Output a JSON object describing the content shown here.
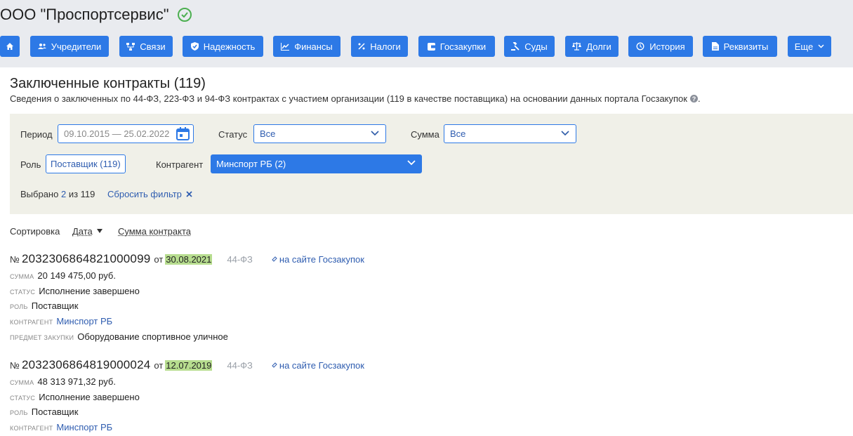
{
  "company": {
    "title": "ООО \"Проспортсервис\""
  },
  "nav": {
    "home_label": "",
    "items": [
      {
        "label": "Учредители",
        "icon": "users-icon"
      },
      {
        "label": "Связи",
        "icon": "links-icon"
      },
      {
        "label": "Надежность",
        "icon": "shield-check-icon"
      },
      {
        "label": "Финансы",
        "icon": "chart-icon"
      },
      {
        "label": "Налоги",
        "icon": "percent-icon"
      },
      {
        "label": "Госзакупки",
        "icon": "wallet-icon"
      },
      {
        "label": "Суды",
        "icon": "gavel-icon"
      },
      {
        "label": "Долги",
        "icon": "scales-icon"
      },
      {
        "label": "История",
        "icon": "history-icon"
      },
      {
        "label": "Реквизиты",
        "icon": "document-icon"
      },
      {
        "label": "Еще",
        "icon": "chevron-down-icon"
      }
    ]
  },
  "section": {
    "title": "Заключенные контракты (119)",
    "description": "Сведения о заключенных по 44-ФЗ, 223-ФЗ и 94-ФЗ контрактах с участием организации (119 в качестве поставщика) на основании данных портала Госзакупок"
  },
  "filters": {
    "period_label": "Период",
    "period_value": "09.10.2015 — 25.02.2022",
    "status_label": "Статус",
    "status_value": "Все",
    "sum_label": "Сумма",
    "sum_value": "Все",
    "role_label": "Роль",
    "role_value": "Поставщик (119)",
    "agent_label": "Контрагент",
    "agent_value": "Минспорт РБ (2)",
    "selected_prefix": "Выбрано",
    "selected_count": "2",
    "selected_suffix": "из 119",
    "reset_label": "Сбросить фильтр"
  },
  "sort": {
    "label": "Сортировка",
    "date_label": "Дата",
    "sum_label": "Сумма контракта"
  },
  "contracts": [
    {
      "no_prefix": "№",
      "number": "2032306864821000099",
      "from_label": "от",
      "date": "30.08.2021",
      "law": "44-ФЗ",
      "link_label": "на сайте Госзакупок",
      "sum_key": "сумма",
      "sum": "20 149 475,00 руб.",
      "status_key": "статус",
      "status": "Исполнение завершено",
      "role_key": "роль",
      "role": "Поставщик",
      "agent_key": "контрагент",
      "agent": "Минспорт РБ",
      "subject_key": "предмет закупки",
      "subject": "Оборудование спортивное уличное"
    },
    {
      "no_prefix": "№",
      "number": "2032306864819000024",
      "from_label": "от",
      "date": "12.07.2019",
      "law": "44-ФЗ",
      "link_label": "на сайте Госзакупок",
      "sum_key": "сумма",
      "sum": "48 313 971,32 руб.",
      "status_key": "статус",
      "status": "Исполнение завершено",
      "role_key": "роль",
      "role": "Поставщик",
      "agent_key": "контрагент",
      "agent": "Минспорт РБ"
    }
  ],
  "colors": {
    "accent": "#2d79e6",
    "header_bg": "#e9ebef",
    "filter_bg": "#f0f0e8",
    "date_highlight": "#b7dd8f",
    "verified": "#4caf50"
  }
}
